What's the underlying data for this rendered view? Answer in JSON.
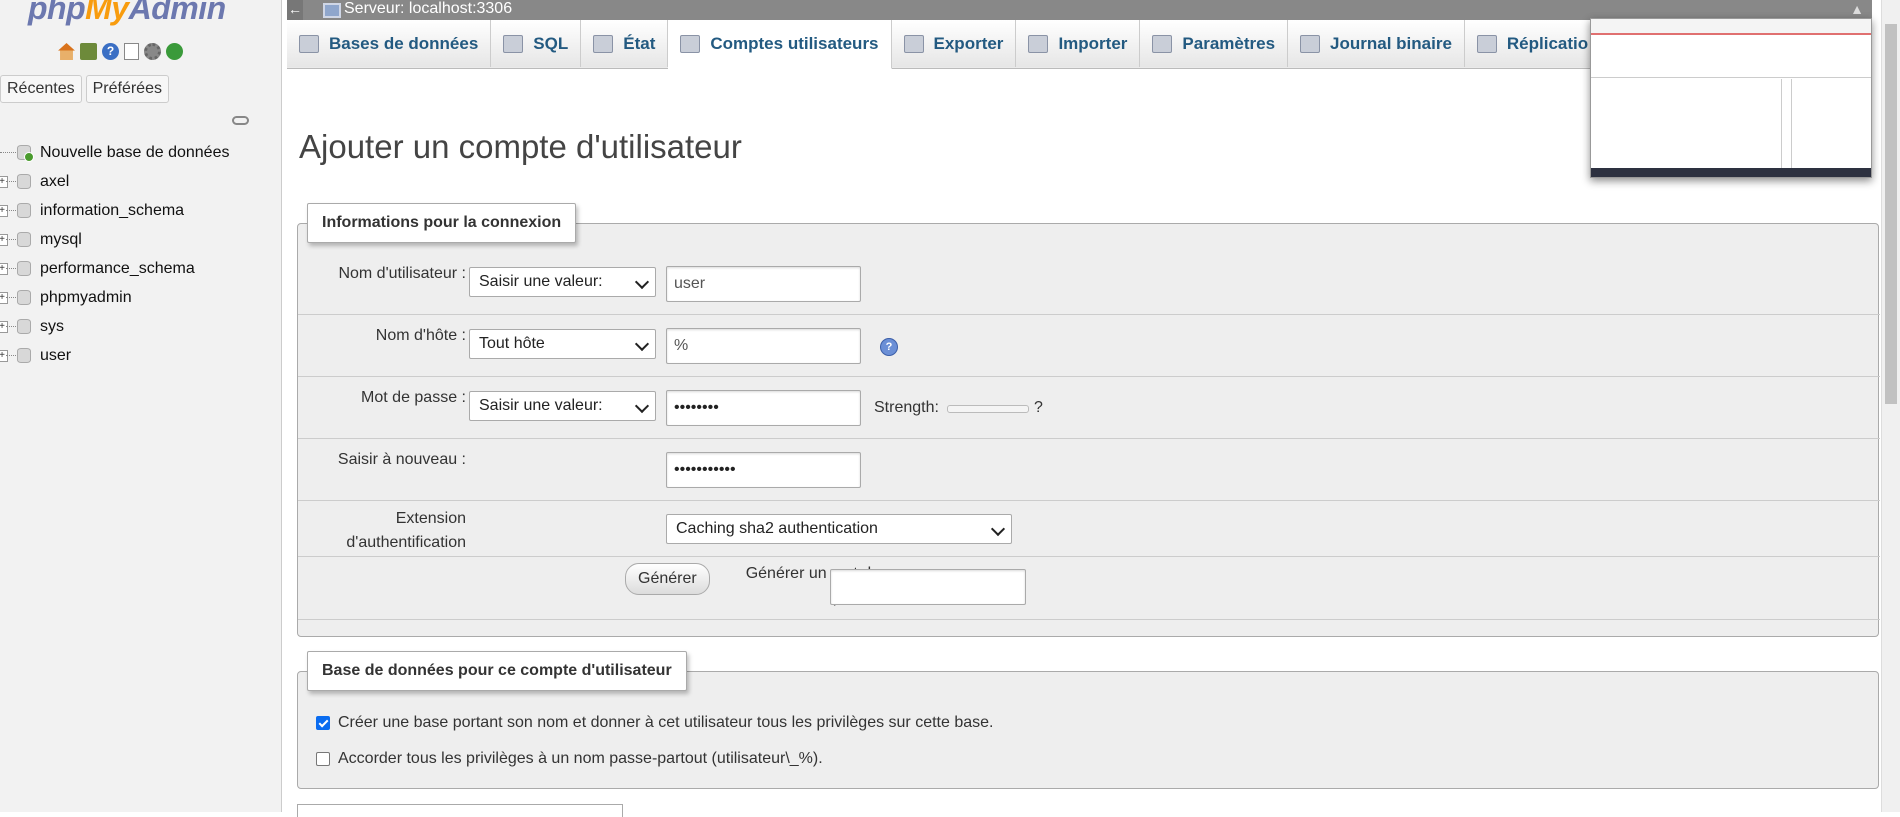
{
  "app": {
    "logo_php": "php",
    "logo_my": "My",
    "logo_admin": "Admin"
  },
  "nav": {
    "icons": [
      "home-icon",
      "database-icon",
      "help-icon",
      "documentation-icon",
      "settings-icon",
      "reload-icon"
    ],
    "tabs": [
      "Récentes",
      "Préférées"
    ],
    "tree": [
      {
        "label": "Nouvelle base de données",
        "expandable": false,
        "new": true
      },
      {
        "label": "axel",
        "expandable": true
      },
      {
        "label": "information_schema",
        "expandable": true
      },
      {
        "label": "mysql",
        "expandable": true
      },
      {
        "label": "performance_schema",
        "expandable": true
      },
      {
        "label": "phpmyadmin",
        "expandable": true
      },
      {
        "label": "sys",
        "expandable": true
      },
      {
        "label": "user",
        "expandable": true
      }
    ]
  },
  "topbar": {
    "back": "←",
    "server": "Serveur: localhost:3306"
  },
  "tabs": [
    {
      "label": "Bases de données",
      "icon": "database-icon",
      "active": false
    },
    {
      "label": "SQL",
      "icon": "sql-icon",
      "active": false
    },
    {
      "label": "État",
      "icon": "status-icon",
      "active": false
    },
    {
      "label": "Comptes utilisateurs",
      "icon": "users-icon",
      "active": true
    },
    {
      "label": "Exporter",
      "icon": "export-icon",
      "active": false
    },
    {
      "label": "Importer",
      "icon": "import-icon",
      "active": false
    },
    {
      "label": "Paramètres",
      "icon": "settings-icon",
      "active": false
    },
    {
      "label": "Journal binaire",
      "icon": "binlog-icon",
      "active": false
    },
    {
      "label": "Réplicatio",
      "icon": "replication-icon",
      "active": false
    }
  ],
  "page": {
    "title": "Ajouter un compte d'utilisateur"
  },
  "login_info": {
    "legend": "Informations pour la connexion",
    "username": {
      "label": "Nom d'utilisateur :",
      "mode": "Saisir une valeur:",
      "value": "user"
    },
    "hostname": {
      "label": "Nom d'hôte :",
      "mode": "Tout hôte",
      "value": "%"
    },
    "password": {
      "label": "Mot de passe :",
      "mode": "Saisir une valeur:",
      "value": "••••••••",
      "strength_label": "Strength:",
      "strength_help": "?"
    },
    "retype": {
      "label": "Saisir à nouveau :",
      "value": "•••••••••••"
    },
    "auth_plugin": {
      "label_line1": "Extension",
      "label_line2": "d'authentification",
      "value": "Caching sha2 authentication"
    },
    "generate": {
      "label_line1": "Générer un mot de",
      "label_line2": "passe:",
      "button": "Générer",
      "value": ""
    }
  },
  "database_section": {
    "legend": "Base de données pour ce compte d'utilisateur",
    "options": [
      {
        "label": "Créer une base portant son nom et donner à cet utilisateur tous les privilèges sur cette base.",
        "checked": true
      },
      {
        "label": "Accorder tous les privilèges à un nom passe-partout (utilisateur\\_%).",
        "checked": false
      }
    ]
  }
}
